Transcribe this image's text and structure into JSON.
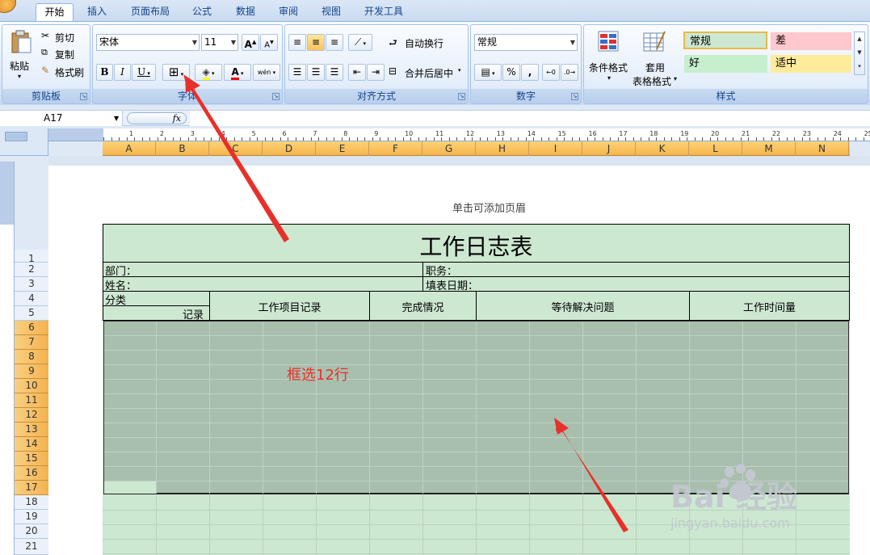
{
  "tabs": [
    "开始",
    "插入",
    "页面布局",
    "公式",
    "数据",
    "审阅",
    "视图",
    "开发工具"
  ],
  "clipboard": {
    "paste": "粘贴",
    "cut": "剪切",
    "copy": "复制",
    "painter": "格式刷",
    "label": "剪贴板"
  },
  "font": {
    "name": "宋体",
    "size": "11",
    "bold": "B",
    "italic": "I",
    "underline": "U",
    "label": "字体",
    "phonetic": "wén"
  },
  "alignment": {
    "wrap": "自动换行",
    "merge": "合并后居中",
    "label": "对齐方式"
  },
  "number": {
    "format": "常规",
    "percent": "%",
    "comma": ",",
    "label": "数字"
  },
  "styles_group": {
    "conditional": "条件格式",
    "table1": "套用",
    "table2": "表格格式",
    "label": "样式",
    "cells": [
      {
        "text": "常规",
        "bg": "#cde8d1"
      },
      {
        "text": "差",
        "bg": "#ffc7ce"
      },
      {
        "text": "好",
        "bg": "#c6efce"
      },
      {
        "text": "适中",
        "bg": "#ffeb9c"
      }
    ]
  },
  "formula_bar": {
    "name_box": "A17",
    "fx": "fx",
    "value": ""
  },
  "columns": [
    "A",
    "B",
    "C",
    "D",
    "E",
    "F",
    "G",
    "H",
    "I",
    "J",
    "K",
    "L",
    "M",
    "N"
  ],
  "rows": [
    "1",
    "2",
    "3",
    "4",
    "5",
    "6",
    "7",
    "8",
    "9",
    "10",
    "11",
    "12",
    "13",
    "14",
    "15",
    "16",
    "17",
    "18",
    "19",
    "20",
    "21"
  ],
  "ruler_numbers": [
    "1",
    "2",
    "3",
    "4",
    "5",
    "6",
    "7",
    "8",
    "9",
    "10",
    "11",
    "12",
    "13",
    "14",
    "15",
    "16",
    "17",
    "18",
    "19",
    "20",
    "21",
    "22",
    "23",
    "24",
    "25"
  ],
  "header_hint": "单击可添加页眉",
  "sheet": {
    "title": "工作日志表",
    "dept": "部门：",
    "position": "职务：",
    "name": "姓名：",
    "fill_date": "填表日期：",
    "category": "分类",
    "record": "记录",
    "col_headers": [
      "工作项目记录",
      "完成情况",
      "等待解决问题",
      "工作时间量"
    ]
  },
  "annotation": "框选12行",
  "watermark": {
    "brand": "Bai 经验",
    "url": "jingyan.baidu.com"
  },
  "colors": {
    "accent": "#e8302a",
    "selection": "#a9bfae",
    "cell_bg": "#cde8d1"
  }
}
